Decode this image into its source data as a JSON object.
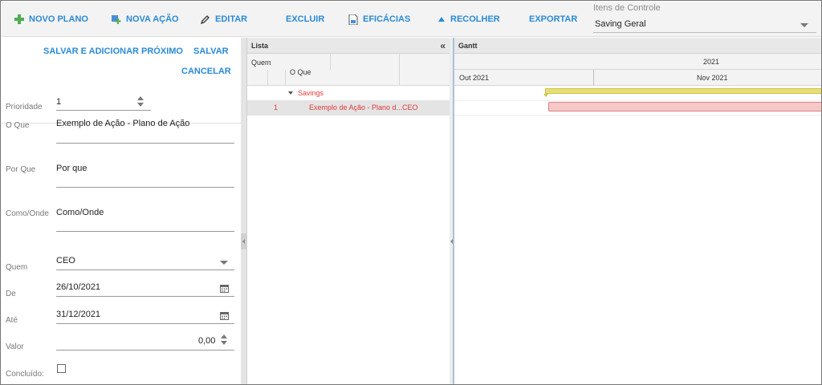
{
  "toolbar": {
    "novo_plano": "NOVO PLANO",
    "nova_acao": "NOVA AÇÃO",
    "editar": "EDITAR",
    "excluir": "EXCLUIR",
    "eficacias": "EFICÁCIAS",
    "recolher": "RECOLHER",
    "exportar": "EXPORTAR",
    "itens_label": "Itens de Controle",
    "itens_value": "Saving Geral"
  },
  "form": {
    "salvar_proximo": "SALVAR E ADICIONAR PRÓXIMO",
    "salvar": "SALVAR",
    "cancelar": "CANCELAR",
    "prioridade_label": "Prioridade",
    "prioridade_value": "1",
    "oque_label": "O Que",
    "oque_value": "Exemplo de Ação - Plano de Ação",
    "porque_label": "Por Que",
    "porque_value": "Por que",
    "comoonde_label": "Como/Onde",
    "comoonde_value": "Como/Onde",
    "quem_label": "Quem",
    "quem_value": "CEO",
    "de_label": "De",
    "de_value": "26/10/2021",
    "ate_label": "Até",
    "ate_value": "31/12/2021",
    "valor_label": "Valor",
    "valor_value": "0,00",
    "concluido_label": "Concluído:"
  },
  "lista": {
    "title": "Lista",
    "col_quem": "Quem",
    "col_oque": "O Que",
    "group": "Savings",
    "row_num": "1",
    "row_oque": "Exemplo de Ação - Plano d...",
    "row_quem": "CEO"
  },
  "gantt": {
    "title": "Gantt",
    "year": "2021",
    "month_1": "Out 2021",
    "month_2": "Nov 2021"
  },
  "colors": {
    "accent": "#2a8ad6",
    "row_text": "#e03a3a",
    "summary_bar": "#e7df74",
    "task_bar": "#f7c8c8"
  }
}
